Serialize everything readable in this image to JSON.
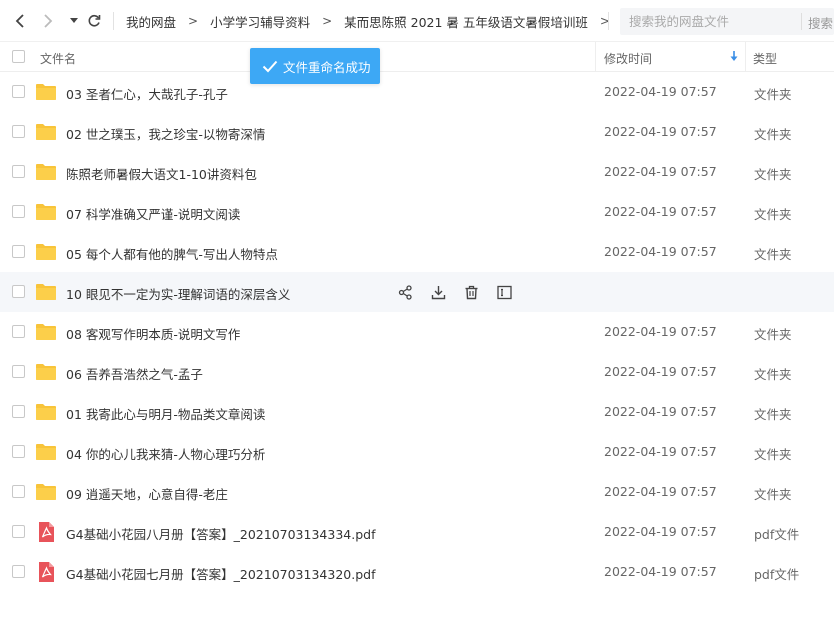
{
  "nav": {
    "back_icon": "chevron-left-icon",
    "forward_icon": "chevron-right-icon",
    "history_icon": "caret-down-icon",
    "refresh_icon": "refresh-icon"
  },
  "breadcrumb": {
    "items": [
      "我的网盘",
      "小学学习辅导资料",
      "某而思陈照 2021 暑 五年级语文暑假培训班"
    ],
    "separator": ">"
  },
  "search": {
    "placeholder": "搜索我的网盘文件",
    "button_label": "搜索"
  },
  "header": {
    "name": "文件名",
    "modified": "修改时间",
    "type": "类型",
    "sort_icon": "arrow-down-icon"
  },
  "toast": {
    "text": "文件重命名成功",
    "icon": "check-icon",
    "color": "#3da8f5"
  },
  "folder_color": "#f8c43a",
  "pdf_color": "#e8535a",
  "files": [
    {
      "name": "03 圣者仁心，大哉孔子-孔子",
      "time": "2022-04-19 07:57",
      "type": "文件夹",
      "kind": "folder"
    },
    {
      "name": "02 世之璞玉，我之珍宝-以物寄深情",
      "time": "2022-04-19 07:57",
      "type": "文件夹",
      "kind": "folder"
    },
    {
      "name": "陈照老师暑假大语文1-10讲资料包",
      "time": "2022-04-19 07:57",
      "type": "文件夹",
      "kind": "folder"
    },
    {
      "name": "07 科学准确又严谨-说明文阅读",
      "time": "2022-04-19 07:57",
      "type": "文件夹",
      "kind": "folder"
    },
    {
      "name": "05 每个人都有他的脾气-写出人物特点",
      "time": "2022-04-19 07:57",
      "type": "文件夹",
      "kind": "folder"
    },
    {
      "name": "10 眼见不一定为实-理解词语的深层含义",
      "time": "",
      "type": "",
      "kind": "folder"
    },
    {
      "name": "08 客观写作明本质-说明文写作",
      "time": "2022-04-19 07:57",
      "type": "文件夹",
      "kind": "folder"
    },
    {
      "name": "06 吾养吾浩然之气-孟子",
      "time": "2022-04-19 07:57",
      "type": "文件夹",
      "kind": "folder"
    },
    {
      "name": "01 我寄此心与明月-物品类文章阅读",
      "time": "2022-04-19 07:57",
      "type": "文件夹",
      "kind": "folder"
    },
    {
      "name": "04 你的心儿我来猜-人物心理巧分析",
      "time": "2022-04-19 07:57",
      "type": "文件夹",
      "kind": "folder"
    },
    {
      "name": "09 逍遥天地，心意自得-老庄",
      "time": "2022-04-19 07:57",
      "type": "文件夹",
      "kind": "folder"
    },
    {
      "name": "G4基础小花园八月册【答案】_20210703134334.pdf",
      "time": "2022-04-19 07:57",
      "type": "pdf文件",
      "kind": "pdf"
    },
    {
      "name": "G4基础小花园七月册【答案】_20210703134320.pdf",
      "time": "2022-04-19 07:57",
      "type": "pdf文件",
      "kind": "pdf"
    }
  ],
  "hover_actions": [
    "share-icon",
    "download-icon",
    "delete-icon",
    "rename-icon"
  ]
}
